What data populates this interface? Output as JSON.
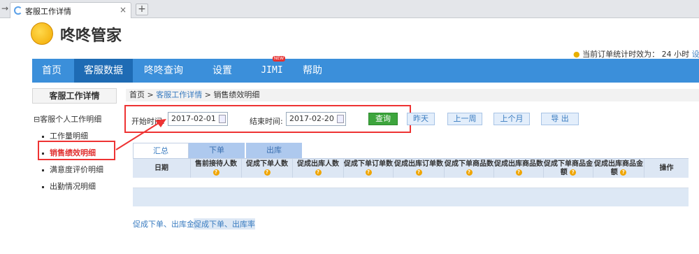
{
  "browser": {
    "tab_title": "客服工作详情",
    "tab_close": "×",
    "new_tab": "+",
    "back": "→"
  },
  "app": {
    "name": "咚咚管家",
    "notice": "当前订单统计时效为：",
    "notice_value": "24 小时",
    "notice_link": "设"
  },
  "nav": {
    "items": [
      "首页",
      "客服数据",
      "咚咚查询",
      "设置",
      "JIMI",
      "帮助"
    ],
    "active": "客服数据",
    "new_badge": "NEW"
  },
  "sidebar": {
    "title": "客服工作详情",
    "group": "客服个人工作明细",
    "group_prefix": "⊟",
    "items": [
      "工作量明细",
      "销售绩效明细",
      "满意度评价明细",
      "出勤情况明细"
    ],
    "active": "销售绩效明细"
  },
  "breadcrumb": {
    "home": "首页",
    "sep": ">",
    "parent": "客服工作详情",
    "current": "销售绩效明细"
  },
  "filter": {
    "start_label": "开始时间:",
    "start_value": "2017-02-01",
    "end_label": "结束时间:",
    "end_value": "2017-02-20",
    "query": "查询",
    "quick": [
      "昨天",
      "上一周",
      "上个月",
      "导 出"
    ]
  },
  "subtabs": [
    "汇总",
    "下单",
    "出库"
  ],
  "table": {
    "columns": [
      "日期",
      "售前接待人数",
      "促成下单人数",
      "促成出库人数",
      "促成下单订单数",
      "促成出库订单数",
      "促成下单商品数",
      "促成出库商品数",
      "促成下单商品金额",
      "促成出库商品金额",
      "操作"
    ]
  },
  "footer_links": [
    "促成下单、出库金额",
    "促成下单、出库率"
  ],
  "colors": {
    "nav": "#3b8fda",
    "nav_active": "#1e6bb4",
    "highlight": "#e33333",
    "query_btn": "#3da53d"
  }
}
